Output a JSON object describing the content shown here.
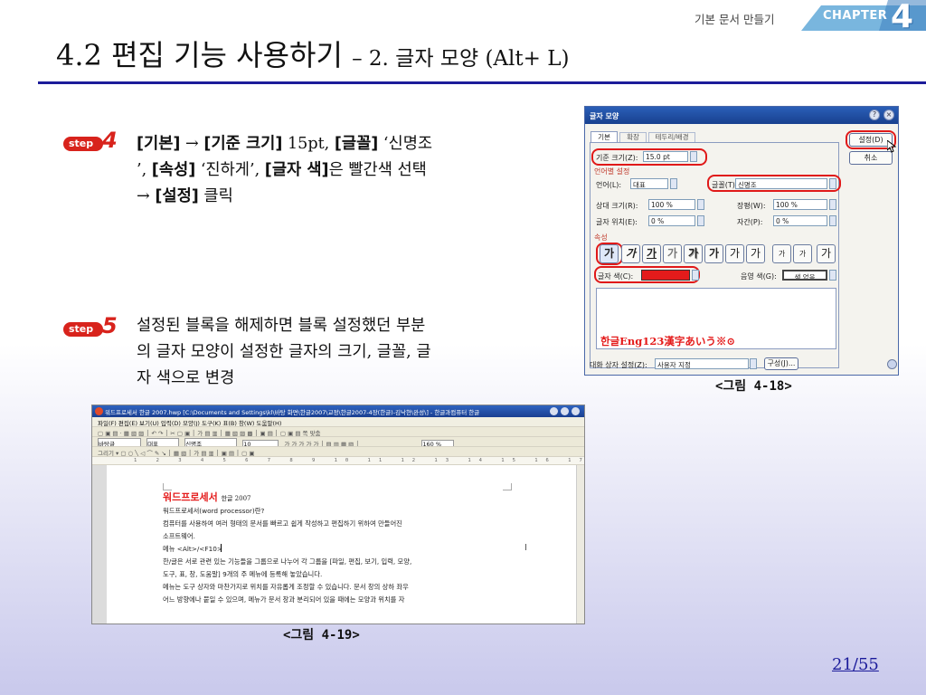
{
  "header": {
    "breadcrumb": "기본 문서 만들기",
    "chapter_label": "CHAPTER",
    "chapter_number": "4"
  },
  "title": {
    "main": "4.2 편집 기능 사용하기",
    "sub": "– 2. 글자 모양 (Alt+ L)"
  },
  "steps": [
    {
      "badge": "step",
      "number": "4",
      "lines": [
        "[기본] → [기준 크기] 15pt, [글꼴] ‘신명조",
        "’, [속성] ‘진하게’, [글자 색]은 빨간색 선택",
        "→ [설정] 클릭"
      ]
    },
    {
      "badge": "step",
      "number": "5",
      "lines": [
        "설정된 블록을 해제하면 블록 설정했던 부분",
        "의 글자 모양이 설정한 글자의 크기, 글꼴, 글",
        "자 색으로 변경"
      ]
    }
  ],
  "dialog": {
    "title": "글자 모양",
    "tabs": [
      "기본",
      "확장",
      "테두리/배경"
    ],
    "base_size_label": "기준 크기(Z):",
    "base_size_value": "15.0 pt",
    "lang_section": "언어별 설정",
    "lang_label": "언어(L):",
    "lang_value": "대표",
    "font_label": "글꼴(T):",
    "font_value": "신명조",
    "rel_size_label": "상대 크기(R):",
    "rel_size_value": "100 %",
    "spacing_label": "장평(W):",
    "spacing_value": "100 %",
    "pos_label": "글자 위치(E):",
    "pos_value": "0 %",
    "gap_label": "자간(P):",
    "gap_value": "0 %",
    "attr_section": "속성",
    "attr_buttons": [
      "가",
      "가",
      "가",
      "가",
      "가",
      "가",
      "가",
      "가",
      "가",
      "가",
      "가"
    ],
    "color_label": "글자 색(C):",
    "color_value": "#e41b1b",
    "shade_label": "음영 색(G):",
    "shade_value": "색 없음",
    "preview_text": "한글Eng123漢字あいう※⊙",
    "dialog_setting_label": "대화 상자 설정(Z):",
    "dialog_setting_value": "사용자 지정",
    "compose_label": "구성(J)...",
    "ok_button": "설정(D)",
    "cancel_button": "취소"
  },
  "figure_captions": {
    "fig18": "<그림 4-18>",
    "fig19": "<그림 4-19>"
  },
  "app": {
    "title": "워드프로세서 한글 2007.hwp [C:\\Documents and Settings\\kl\\바탕 화면\\한글2007\\교정\\한글2007-4장(한글)-김낙현\\완성\\] - 한글과컴퓨터 한글",
    "menu": "파일(F) 편집(E) 보기(U) 입력(D) 모양(J) 도구(K) 표(B) 창(W) 도움말(H)",
    "toolbar1": "▢ ▣ ▤ · ▦ ▧ ▨ │ ↶ ↷ │ ✂ ▢ ▣ │ 가 ▤ ▥ │ ▦ ▧ ▨ ▩ │ ▣ ▤ │ ▢ ▣ ▤ 쪽 맞춤",
    "toolbar2_style": "바탕글",
    "toolbar2_lang": "대표",
    "toolbar2_font": "신명조",
    "toolbar2_size": "10",
    "toolbar2_zoom": "160 %",
    "toolbar3": "그리기 ▾ ▢ ○ ╲ ◁ ⌒ ✎ ↘ │ ▦ ▧ │ 가 ▤ ▥ │ ▣ ▤ │ ▢ ▣",
    "ruler": "1  2  3  4  5  6  7  8  9  10  11  12  13  14  15  16  17  18",
    "doc_title": "워드프로세서",
    "doc_title_suffix": "한글 2007",
    "doc_lines": [
      "워드프로세서(word processor)란?",
      "컴퓨터를 사용하여 여러 형태의 문서를 빠르고 쉽게 작성하고 편집하기 위하여 만들어진",
      "소프트웨어.",
      "메뉴 <Alt>/<F10>",
      "한/글은 서로 관련 있는 기능들을 그룹으로 나누어 각 그룹을 [파일, 편집, 보기, 입력, 모양,",
      "도구, 표, 창, 도움말] 9개의 주 메뉴에 등록해 놓았습니다.",
      "메뉴는 도구 상자와 마찬가지로 위치를 자유롭게 조정할 수 있습니다. 문서 창의 상하 좌우",
      "어느 방향에나 붙일 수 있으며, 메뉴가 문서 창과 분리되어 있을 때에는 모양과 위치를 자"
    ]
  },
  "page_number": "21/55"
}
